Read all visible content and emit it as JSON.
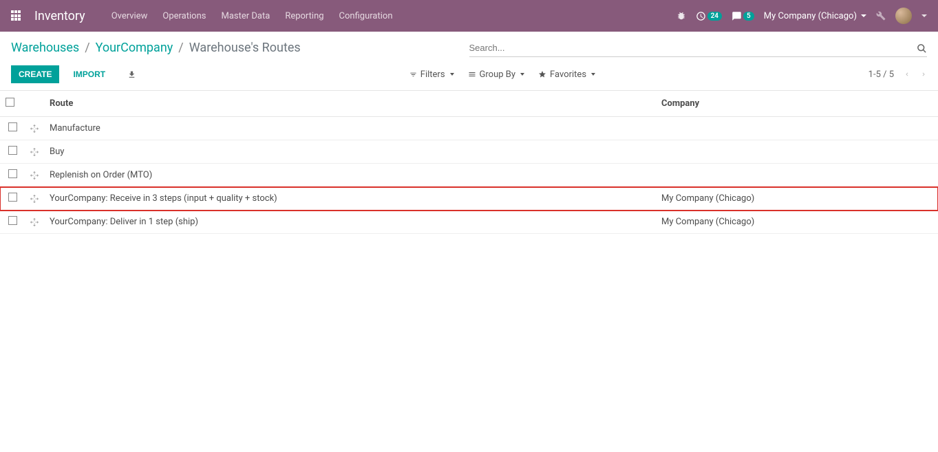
{
  "navbar": {
    "app_title": "Inventory",
    "menu": [
      "Overview",
      "Operations",
      "Master Data",
      "Reporting",
      "Configuration"
    ],
    "badge_clock": "24",
    "badge_chat": "5",
    "company": "My Company (Chicago)"
  },
  "breadcrumb": {
    "items": [
      "Warehouses",
      "YourCompany"
    ],
    "current": "Warehouse's Routes"
  },
  "search": {
    "placeholder": "Search..."
  },
  "buttons": {
    "create": "CREATE",
    "import": "IMPORT"
  },
  "filters": {
    "filters_label": "Filters",
    "groupby_label": "Group By",
    "favorites_label": "Favorites"
  },
  "pager": "1-5 / 5",
  "table": {
    "headers": {
      "route": "Route",
      "company": "Company"
    },
    "rows": [
      {
        "route": "Manufacture",
        "company": ""
      },
      {
        "route": "Buy",
        "company": ""
      },
      {
        "route": "Replenish on Order (MTO)",
        "company": ""
      },
      {
        "route": "YourCompany: Receive in 3 steps (input + quality + stock)",
        "company": "My Company (Chicago)",
        "highlight": true
      },
      {
        "route": "YourCompany: Deliver in 1 step (ship)",
        "company": "My Company (Chicago)"
      }
    ]
  }
}
